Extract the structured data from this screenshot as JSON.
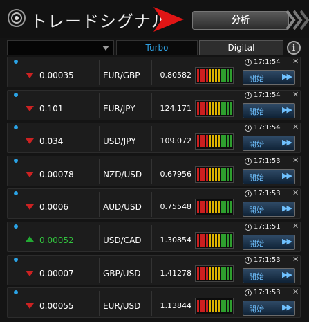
{
  "header": {
    "title": "トレードシグナル",
    "analysis_label": "分析"
  },
  "filter": {
    "dropdown_value": "",
    "tab_turbo": "Turbo",
    "tab_digital": "Digital",
    "info_symbol": "i"
  },
  "meter_colors": [
    "#cc1f1f",
    "#cc1f1f",
    "#cc1f1f",
    "#cc1f1f",
    "#e0b400",
    "#e0b400",
    "#e0b400",
    "#e0b400",
    "#2e9e2e",
    "#2e9e2e",
    "#2e9e2e",
    "#2e9e2e"
  ],
  "signals": [
    {
      "direction": "down",
      "value": "0.00035",
      "pair": "EUR/GBP",
      "rate": "0.80582",
      "time": "17:1:54",
      "button": "開始"
    },
    {
      "direction": "down",
      "value": "0.101",
      "pair": "EUR/JPY",
      "rate": "124.171",
      "time": "17:1:54",
      "button": "開始"
    },
    {
      "direction": "down",
      "value": "0.034",
      "pair": "USD/JPY",
      "rate": "109.072",
      "time": "17:1:54",
      "button": "開始"
    },
    {
      "direction": "down",
      "value": "0.00078",
      "pair": "NZD/USD",
      "rate": "0.67956",
      "time": "17:1:53",
      "button": "開始"
    },
    {
      "direction": "down",
      "value": "0.0006",
      "pair": "AUD/USD",
      "rate": "0.75548",
      "time": "17:1:53",
      "button": "開始"
    },
    {
      "direction": "up",
      "value": "0.00052",
      "pair": "USD/CAD",
      "rate": "1.30854",
      "time": "17:1:51",
      "button": "開始"
    },
    {
      "direction": "down",
      "value": "0.00007",
      "pair": "GBP/USD",
      "rate": "1.41278",
      "time": "17:1:53",
      "button": "開始"
    },
    {
      "direction": "down",
      "value": "0.00055",
      "pair": "EUR/USD",
      "rate": "1.13844",
      "time": "17:1:53",
      "button": "開始"
    }
  ]
}
